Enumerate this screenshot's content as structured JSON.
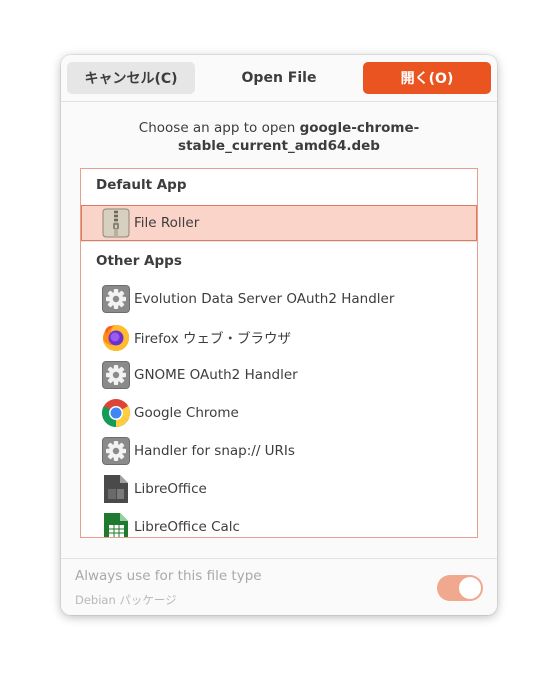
{
  "header": {
    "cancel_label": "キャンセル(C)",
    "title": "Open File",
    "open_label": "開く(O)"
  },
  "prompt": {
    "prefix": "Choose an app to open ",
    "filename_line1": "google-chrome-",
    "filename_line2": "stable_current_amd64.deb"
  },
  "list": {
    "default_header": "Default App",
    "default_app": {
      "label": "File Roller",
      "icon": "archive-icon"
    },
    "other_header": "Other Apps",
    "other_apps": [
      {
        "label": "Evolution Data Server OAuth2 Handler",
        "icon": "gear-icon"
      },
      {
        "label": "Firefox ウェブ・ブラウザ",
        "icon": "firefox-icon"
      },
      {
        "label": "GNOME OAuth2 Handler",
        "icon": "gear-icon"
      },
      {
        "label": "Google Chrome",
        "icon": "chrome-icon"
      },
      {
        "label": "Handler for snap:// URIs",
        "icon": "gear-icon"
      },
      {
        "label": "LibreOffice",
        "icon": "libreoffice-icon"
      },
      {
        "label": "LibreOffice Calc",
        "icon": "libreoffice-calc-icon"
      }
    ]
  },
  "footer": {
    "always_use_label": "Always use for this file type",
    "file_type_label": "Debian パッケージ",
    "toggle_on": true
  },
  "colors": {
    "accent": "#e95420",
    "selection_bg": "#fad4c8",
    "selection_border": "#e07a5f"
  }
}
